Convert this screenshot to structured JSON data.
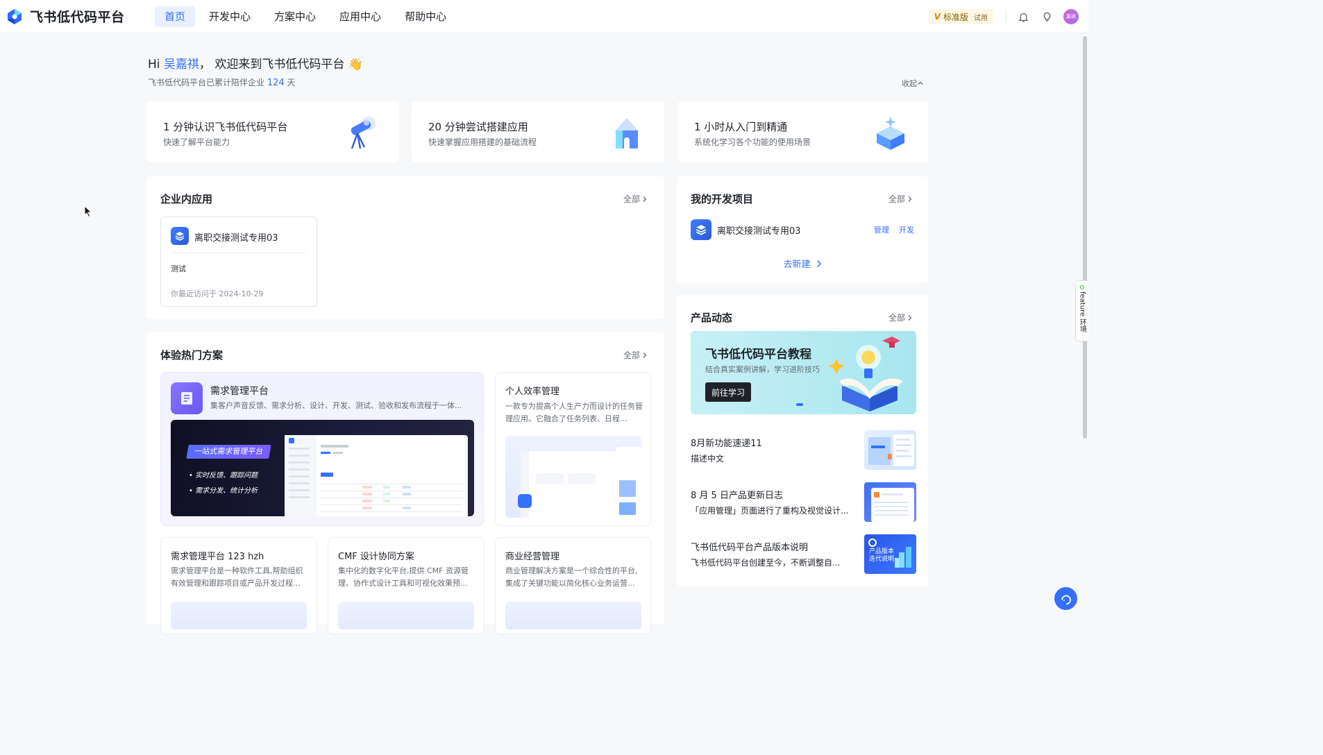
{
  "app": {
    "title": "飞书低代码平台"
  },
  "nav": [
    {
      "label": "首页",
      "active": true
    },
    {
      "label": "开发中心",
      "active": false
    },
    {
      "label": "方案中心",
      "active": false
    },
    {
      "label": "应用中心",
      "active": false
    },
    {
      "label": "帮助中心",
      "active": false
    }
  ],
  "header": {
    "plan_label": "标准版",
    "plan_trial": "试用",
    "avatar_text": "嘉祺"
  },
  "greeting": {
    "hi": "Hi ",
    "user": "吴嘉祺",
    "rest": "， 欢迎来到飞书低代码平台 👋",
    "sub_prefix": "飞书低代码平台已累计陪伴企业 ",
    "days": "124",
    "sub_suffix": " 天",
    "collapse": "收起"
  },
  "quick": [
    {
      "title": "1 分钟认识飞书低代码平台",
      "sub": "快速了解平台能力",
      "icon": "telescope-icon"
    },
    {
      "title": "20 分钟尝试搭建应用",
      "sub": "快速掌握应用搭建的基础流程",
      "icon": "house-icon"
    },
    {
      "title": "1 小时从入门到精通",
      "sub": "系统化学习各个功能的使用场景",
      "icon": "cube-icon"
    }
  ],
  "enterprise_apps": {
    "title": "企业内应用",
    "more": "全部",
    "app": {
      "name": "离职交接测试专用03",
      "desc": "测试",
      "visited": "你最近访问于 2024-10-29"
    }
  },
  "solutions": {
    "title": "体验热门方案",
    "more": "全部",
    "featured": {
      "title": "需求管理平台",
      "desc": "集客户声音反馈、需求分析、设计、开发、测试、验收和发布流程于一体...",
      "banner": "一站式需求管理平台",
      "bullet1": "实时反馈、跟踪问题",
      "bullet2": "需求分发、统计分析"
    },
    "items": [
      {
        "title": "个人效率管理",
        "desc": "一款专为提高个人生产力而设计的任务管理应用。它融合了任务列表、日程..."
      },
      {
        "title": "需求管理平台 123 hzh",
        "desc": "需求管理平台是一种软件工具,帮助组织有效管理和跟踪项目或产品开发过程..."
      },
      {
        "title": "CMF 设计协同方案",
        "desc": "集中化的数字化平台,提供 CMF 资源管理、协作式设计工具和可视化效果预..."
      },
      {
        "title": "商业经营管理",
        "desc": "商业管理解决方案是一个综合性的平台,集成了关键功能以简化核心业务运营..."
      }
    ]
  },
  "projects": {
    "title": "我的开发项目",
    "more": "全部",
    "item": {
      "name": "离职交接测试专用03",
      "manage": "管理",
      "develop": "开发"
    },
    "new_label": "去新建"
  },
  "news": {
    "title": "产品动态",
    "more": "全部",
    "promo": {
      "title": "飞书低代码平台教程",
      "sub": "结合真实案例讲解，学习进阶技巧",
      "button": "前往学习"
    },
    "items": [
      {
        "title": "8月新功能速递11",
        "desc": "描述中文"
      },
      {
        "title": "8 月 5 日产品更新日志",
        "desc": "「应用管理」页面进行了重构及视觉设计..."
      },
      {
        "title": "飞书低代码平台产品版本说明",
        "desc": "飞书低代码平台创建至今，不断调整自...",
        "thumb_text1": "产品版本",
        "thumb_text2": "迭代说明"
      }
    ]
  },
  "side": {
    "feature_tab": "feature 环境"
  },
  "colors": {
    "accent": "#3370ff",
    "text": "#1f2329",
    "muted": "#646a73"
  }
}
